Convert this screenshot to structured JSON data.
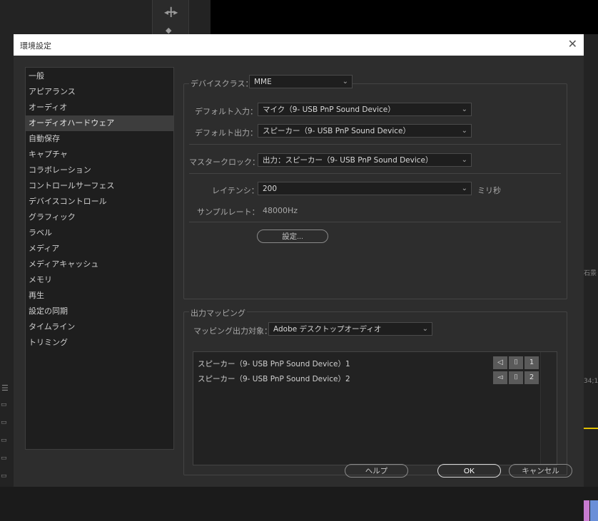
{
  "dialog": {
    "title": "環境設定",
    "close_glyph": "✕"
  },
  "sidebar": {
    "items": [
      {
        "label": "一般"
      },
      {
        "label": "アピアランス"
      },
      {
        "label": "オーディオ"
      },
      {
        "label": "オーディオハードウェア",
        "selected": true
      },
      {
        "label": "自動保存"
      },
      {
        "label": "キャプチャ"
      },
      {
        "label": "コラボレーション"
      },
      {
        "label": "コントロールサーフェス"
      },
      {
        "label": "デバイスコントロール"
      },
      {
        "label": "グラフィック"
      },
      {
        "label": "ラベル"
      },
      {
        "label": "メディア"
      },
      {
        "label": "メディアキャッシュ"
      },
      {
        "label": "メモリ"
      },
      {
        "label": "再生"
      },
      {
        "label": "設定の同期"
      },
      {
        "label": "タイムライン"
      },
      {
        "label": "トリミング"
      }
    ]
  },
  "hardware": {
    "device_class_label": "デバイスクラス：",
    "device_class_value": "MME",
    "default_input_label": "デフォルト入力：",
    "default_input_value": "マイク（9- USB PnP Sound Device）",
    "default_output_label": "デフォルト出力：",
    "default_output_value": "スピーカー（9- USB PnP Sound Device）",
    "master_clock_label": "マスタークロック：",
    "master_clock_value": "出力：スピーカー（9- USB PnP Sound Device）",
    "latency_label": "レイテンシ：",
    "latency_value": "200",
    "latency_unit": "ミリ秒",
    "sample_rate_label": "サンプルレート：",
    "sample_rate_value": "48000Hz",
    "settings_button": "設定..."
  },
  "mapping": {
    "group_label": "出力マッピング",
    "target_label": "マッピング出力対象：",
    "target_value": "Adobe デスクトップオーディオ",
    "rows": [
      {
        "name": "スピーカー（9- USB PnP Sound Device）1",
        "channel": "1",
        "icon": "speaker-left-icon"
      },
      {
        "name": "スピーカー（9- USB PnP Sound Device）2",
        "channel": "2",
        "icon": "speaker-right-icon"
      }
    ]
  },
  "footer": {
    "help_button": "ヘルプ",
    "ok_button": "OK",
    "cancel_button": "キャンセル"
  },
  "background": {
    "right_panel_label": "石景",
    "timecode_fragment": "34;1"
  },
  "colors": {
    "dialog_bg": "#2d2d2d",
    "titlebar_bg": "#ffffff",
    "selected_item_bg": "#3d3d3d",
    "timeline_playhead": "#e0c000"
  }
}
